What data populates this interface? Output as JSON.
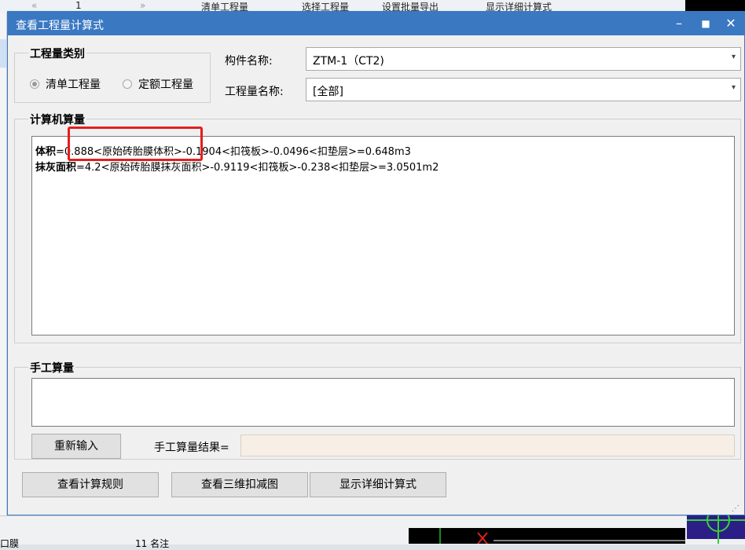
{
  "background": {
    "toolbar": {
      "page_number": "1",
      "items": [
        "清单工程量",
        "选择工程量",
        "设置批量导出",
        "显示详细计算式"
      ]
    },
    "bottom_strip": {
      "left_text": "口膜",
      "middle_text": "11 名注"
    }
  },
  "dialog": {
    "title": "查看工程量计算式",
    "quantity_type_group": {
      "label": "工程量类别",
      "options": [
        {
          "label": "清单工程量",
          "selected": true
        },
        {
          "label": "定额工程量",
          "selected": false
        }
      ]
    },
    "component_name": {
      "label": "构件名称:",
      "value": "ZTM-1（CT2)"
    },
    "quantity_name": {
      "label": "工程量名称:",
      "value": "[全部]"
    },
    "computer_calc": {
      "label": "计算机算量",
      "lines": [
        {
          "name": "体积",
          "expression": "=0.888<原始砖胎膜体积>-0.1904<扣筏板>-0.0496<扣垫层>=0.648m3"
        },
        {
          "name": "抹灰面积",
          "expression": "=4.2<原始砖胎膜抹灰面积>-0.9119<扣筏板>-0.238<扣垫层>=3.0501m2"
        }
      ]
    },
    "manual_calc": {
      "label": "手工算量",
      "reenter_button": "重新输入",
      "result_label": "手工算量结果=",
      "result_value": ""
    },
    "buttons": {
      "view_rules": "查看计算规则",
      "view_3d": "查看三维扣减图",
      "show_detail": "显示详细计算式"
    },
    "colors": {
      "title_bar": "#3a78c2",
      "highlight": "#e31e1e",
      "result_box": "#f7eee6"
    }
  }
}
